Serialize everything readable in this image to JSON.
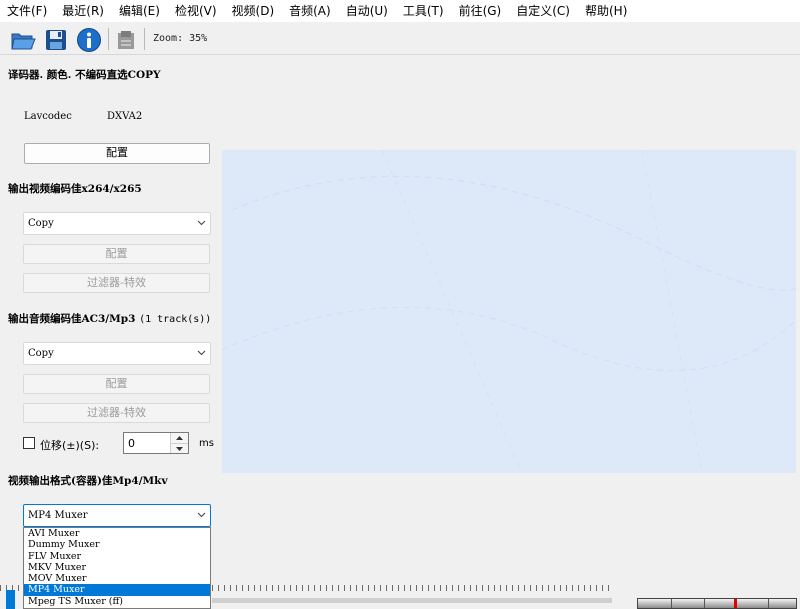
{
  "menubar": {
    "items": [
      "文件(F)",
      "最近(R)",
      "编辑(E)",
      "检视(V)",
      "视频(D)",
      "音频(A)",
      "自动(U)",
      "工具(T)",
      "前往(G)",
      "自定义(C)",
      "帮助(H)"
    ]
  },
  "toolbar": {
    "zoom": "Zoom: 35%",
    "icons": [
      "open-folder-icon",
      "save-disk-icon",
      "info-icon",
      "disabled-tool-icon"
    ]
  },
  "decoder": {
    "title": "译码器. 颜色. 不编码直选COPY",
    "lib_label": "Lavcodec",
    "hw_label": "DXVA2",
    "config_label": "配置"
  },
  "video_output": {
    "title": "输出视频编码佳x264/x265",
    "codec_value": "Copy",
    "config_label": "配置",
    "filters_label": "过滤器-特效"
  },
  "audio_output": {
    "title": "输出音频编码佳AC3/Mp3",
    "tracks_note": "(1 track(s))",
    "codec_value": "Copy",
    "config_label": "配置",
    "filters_label": "过滤器-特效",
    "shift_label": "位移(±)(S):",
    "shift_value": "0",
    "shift_unit": "ms",
    "shift_checked": false
  },
  "container": {
    "title": "视频输出格式(容器)佳Mp4/Mkv",
    "selected": "MP4 Muxer",
    "options": [
      "AVI Muxer",
      "Dummy Muxer",
      "FLV Muxer",
      "MKV Muxer",
      "MOV Muxer",
      "MP4 Muxer",
      "Mpeg TS Muxer (ff)"
    ],
    "highlighted_index": 5
  },
  "colors": {
    "accent": "#0078d7",
    "preview_bg": "#dde8f8",
    "meter_cursor": "#e00000"
  }
}
